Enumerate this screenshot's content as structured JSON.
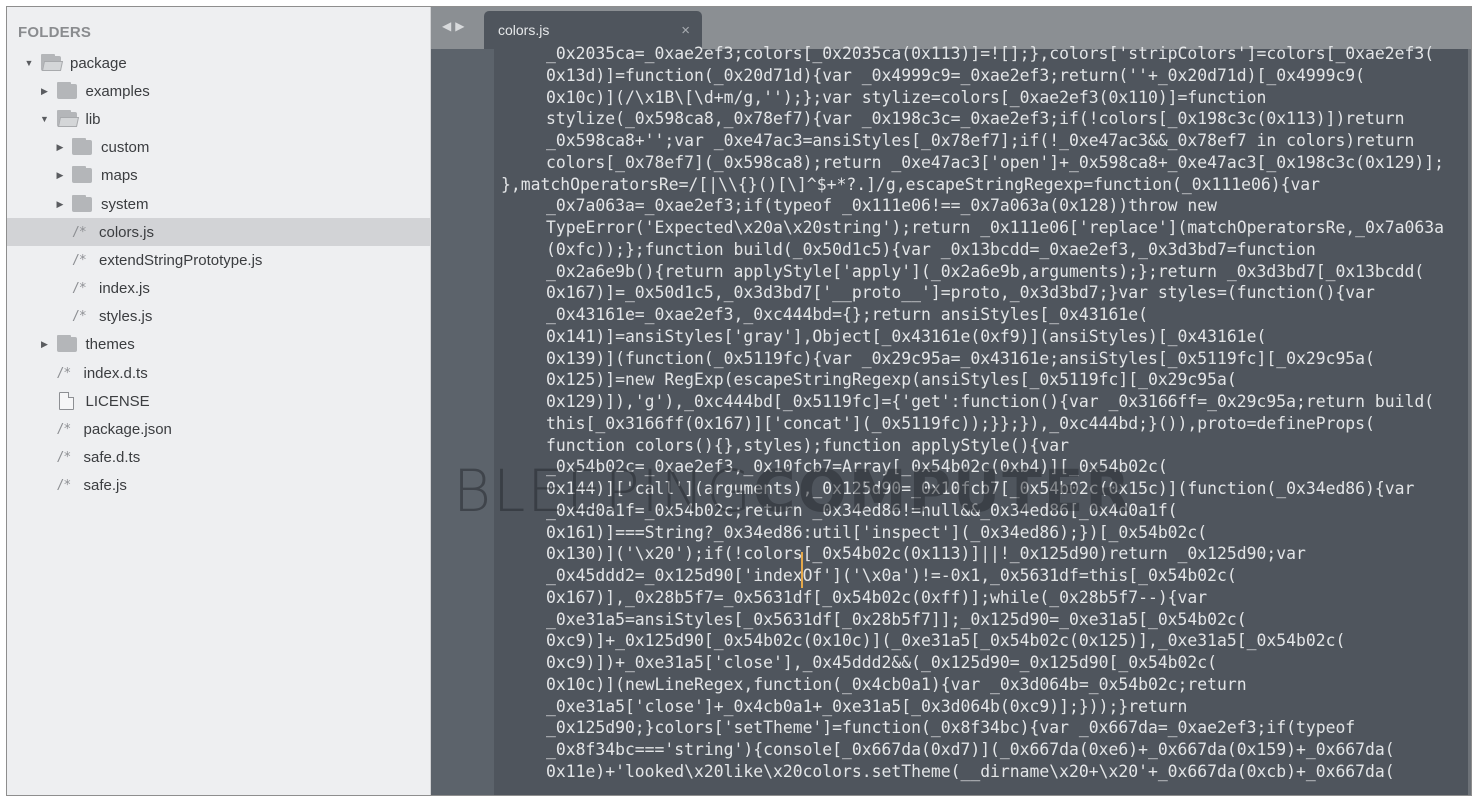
{
  "sidebar": {
    "header": "FOLDERS",
    "items": [
      {
        "label": "package",
        "type": "folder",
        "expanded": true,
        "depth": 0
      },
      {
        "label": "examples",
        "type": "folder",
        "expanded": false,
        "depth": 1
      },
      {
        "label": "lib",
        "type": "folder",
        "expanded": true,
        "depth": 1
      },
      {
        "label": "custom",
        "type": "folder",
        "expanded": false,
        "depth": 2
      },
      {
        "label": "maps",
        "type": "folder",
        "expanded": false,
        "depth": 2
      },
      {
        "label": "system",
        "type": "folder",
        "expanded": false,
        "depth": 2
      },
      {
        "label": "colors.js",
        "type": "code-file",
        "depth": 2,
        "selected": true
      },
      {
        "label": "extendStringPrototype.js",
        "type": "code-file",
        "depth": 2
      },
      {
        "label": "index.js",
        "type": "code-file",
        "depth": 2
      },
      {
        "label": "styles.js",
        "type": "code-file",
        "depth": 2
      },
      {
        "label": "themes",
        "type": "folder",
        "expanded": false,
        "depth": 1
      },
      {
        "label": "index.d.ts",
        "type": "code-file",
        "depth": 1
      },
      {
        "label": "LICENSE",
        "type": "plain-file",
        "depth": 1
      },
      {
        "label": "package.json",
        "type": "code-file",
        "depth": 1
      },
      {
        "label": "safe.d.ts",
        "type": "code-file",
        "depth": 1
      },
      {
        "label": "safe.js",
        "type": "code-file",
        "depth": 1
      }
    ],
    "code_file_glyph": "/*"
  },
  "tabbar": {
    "back_arrow": "◀",
    "forward_arrow": "▶",
    "tabs": [
      {
        "label": "colors.js",
        "close": "×",
        "active": true
      }
    ]
  },
  "editor": {
    "lines": [
      {
        "text": "_0x2035ca=_0xae2ef3;colors[_0x2035ca(0x113)]=![];},colors['stripColors']=colors[_0xae2ef3(",
        "indent": true
      },
      {
        "text": "0x13d)]=function(_0x20d71d){var _0x4999c9=_0xae2ef3;return(''+_0x20d71d)[_0x4999c9(",
        "indent": true
      },
      {
        "text": "0x10c)](/\\x1B\\[\\d+m/g,'');};var stylize=colors[_0xae2ef3(0x110)]=function",
        "indent": true
      },
      {
        "text": "stylize(_0x598ca8,_0x78ef7){var _0x198c3c=_0xae2ef3;if(!colors[_0x198c3c(0x113)])return",
        "indent": true
      },
      {
        "text": "_0x598ca8+'';var _0xe47ac3=ansiStyles[_0x78ef7];if(!_0xe47ac3&&_0x78ef7 in colors)return",
        "indent": true
      },
      {
        "text": "colors[_0x78ef7](_0x598ca8);return _0xe47ac3['open']+_0x598ca8+_0xe47ac3[_0x198c3c(0x129)];",
        "indent": true
      },
      {
        "text": "},matchOperatorsRe=/[|\\\\{}()[\\]^$+*?.]/g,escapeStringRegexp=function(_0x111e06){var",
        "indent": false
      },
      {
        "text": "_0x7a063a=_0xae2ef3;if(typeof _0x111e06!==_0x7a063a(0x128))throw new",
        "indent": true
      },
      {
        "text": "TypeError('Expected\\x20a\\x20string');return _0x111e06['replace'](matchOperatorsRe,_0x7a063a",
        "indent": true
      },
      {
        "text": "(0xfc));};function build(_0x50d1c5){var _0x13bcdd=_0xae2ef3,_0x3d3bd7=function",
        "indent": true
      },
      {
        "text": "_0x2a6e9b(){return applyStyle['apply'](_0x2a6e9b,arguments);};return _0x3d3bd7[_0x13bcdd(",
        "indent": true
      },
      {
        "text": "0x167)]=_0x50d1c5,_0x3d3bd7['__proto__']=proto,_0x3d3bd7;}var styles=(function(){var",
        "indent": true
      },
      {
        "text": "_0x43161e=_0xae2ef3,_0xc444bd={};return ansiStyles[_0x43161e(",
        "indent": true
      },
      {
        "text": "0x141)]=ansiStyles['gray'],Object[_0x43161e(0xf9)](ansiStyles)[_0x43161e(",
        "indent": true
      },
      {
        "text": "0x139)](function(_0x5119fc){var _0x29c95a=_0x43161e;ansiStyles[_0x5119fc][_0x29c95a(",
        "indent": true
      },
      {
        "text": "0x125)]=new RegExp(escapeStringRegexp(ansiStyles[_0x5119fc][_0x29c95a(",
        "indent": true
      },
      {
        "text": "0x129)]),'g'),_0xc444bd[_0x5119fc]={'get':function(){var _0x3166ff=_0x29c95a;return build(",
        "indent": true
      },
      {
        "text": "this[_0x3166ff(0x167)]['concat'](_0x5119fc));}};}),_0xc444bd;}()),proto=defineProps(",
        "indent": true
      },
      {
        "text": "function colors(){},styles);function applyStyle(){var",
        "indent": true
      },
      {
        "text": "_0x54b02c=_0xae2ef3,_0x10fcb7=Array[_0x54b02c(0xb4)][_0x54b02c(",
        "indent": true
      },
      {
        "text": "0x144)]['call'](arguments),_0x125d90=_0x10fcb7[_0x54b02c(0x15c)](function(_0x34ed86){var",
        "indent": true
      },
      {
        "text": "_0x4d0a1f=_0x54b02c;return _0x34ed86!=null&&_0x34ed86[_0x4d0a1f(",
        "indent": true
      },
      {
        "text": "0x161)]===String?_0x34ed86:util['inspect'](_0x34ed86);})[_0x54b02c(",
        "indent": true
      },
      {
        "text": "0x130)]('\\x20');if(!colors[_0x54b02c(0x113)]||!_0x125d90)return _0x125d90;var",
        "indent": true
      },
      {
        "text": "_0x45ddd2=_0x125d90['indexOf']('\\x0a')!=-0x1,_0x5631df=this[_0x54b02c(",
        "indent": true
      },
      {
        "text": "0x167)],_0x28b5f7=_0x5631df[_0x54b02c(0xff)];while(_0x28b5f7--){var",
        "indent": true
      },
      {
        "text": "_0xe31a5=ansiStyles[_0x5631df[_0x28b5f7]];_0x125d90=_0xe31a5[_0x54b02c(",
        "indent": true
      },
      {
        "text": "0xc9)]+_0x125d90[_0x54b02c(0x10c)](_0xe31a5[_0x54b02c(0x125)],_0xe31a5[_0x54b02c(",
        "indent": true
      },
      {
        "text": "0xc9)])+_0xe31a5['close'],_0x45ddd2&&(_0x125d90=_0x125d90[_0x54b02c(",
        "indent": true
      },
      {
        "text": "0x10c)](newLineRegex,function(_0x4cb0a1){var _0x3d064b=_0x54b02c;return",
        "indent": true
      },
      {
        "text": "_0xe31a5['close']+_0x4cb0a1+_0xe31a5[_0x3d064b(0xc9)];}));}return",
        "indent": true
      },
      {
        "text": "_0x125d90;}colors['setTheme']=function(_0x8f34bc){var _0x667da=_0xae2ef3;if(typeof",
        "indent": true
      },
      {
        "text": "_0x8f34bc==='string'){console[_0x667da(0xd7)](_0x667da(0xe6)+_0x667da(0x159)+_0x667da(",
        "indent": true
      },
      {
        "text": "0x11e)+'looked\\x20like\\x20colors.setTheme(__dirname\\x20+\\x20'+_0x667da(0xcb)+_0x667da(",
        "indent": true
      }
    ]
  },
  "watermark": {
    "light": "BLEEPING",
    "bold": "COMPUTER"
  }
}
